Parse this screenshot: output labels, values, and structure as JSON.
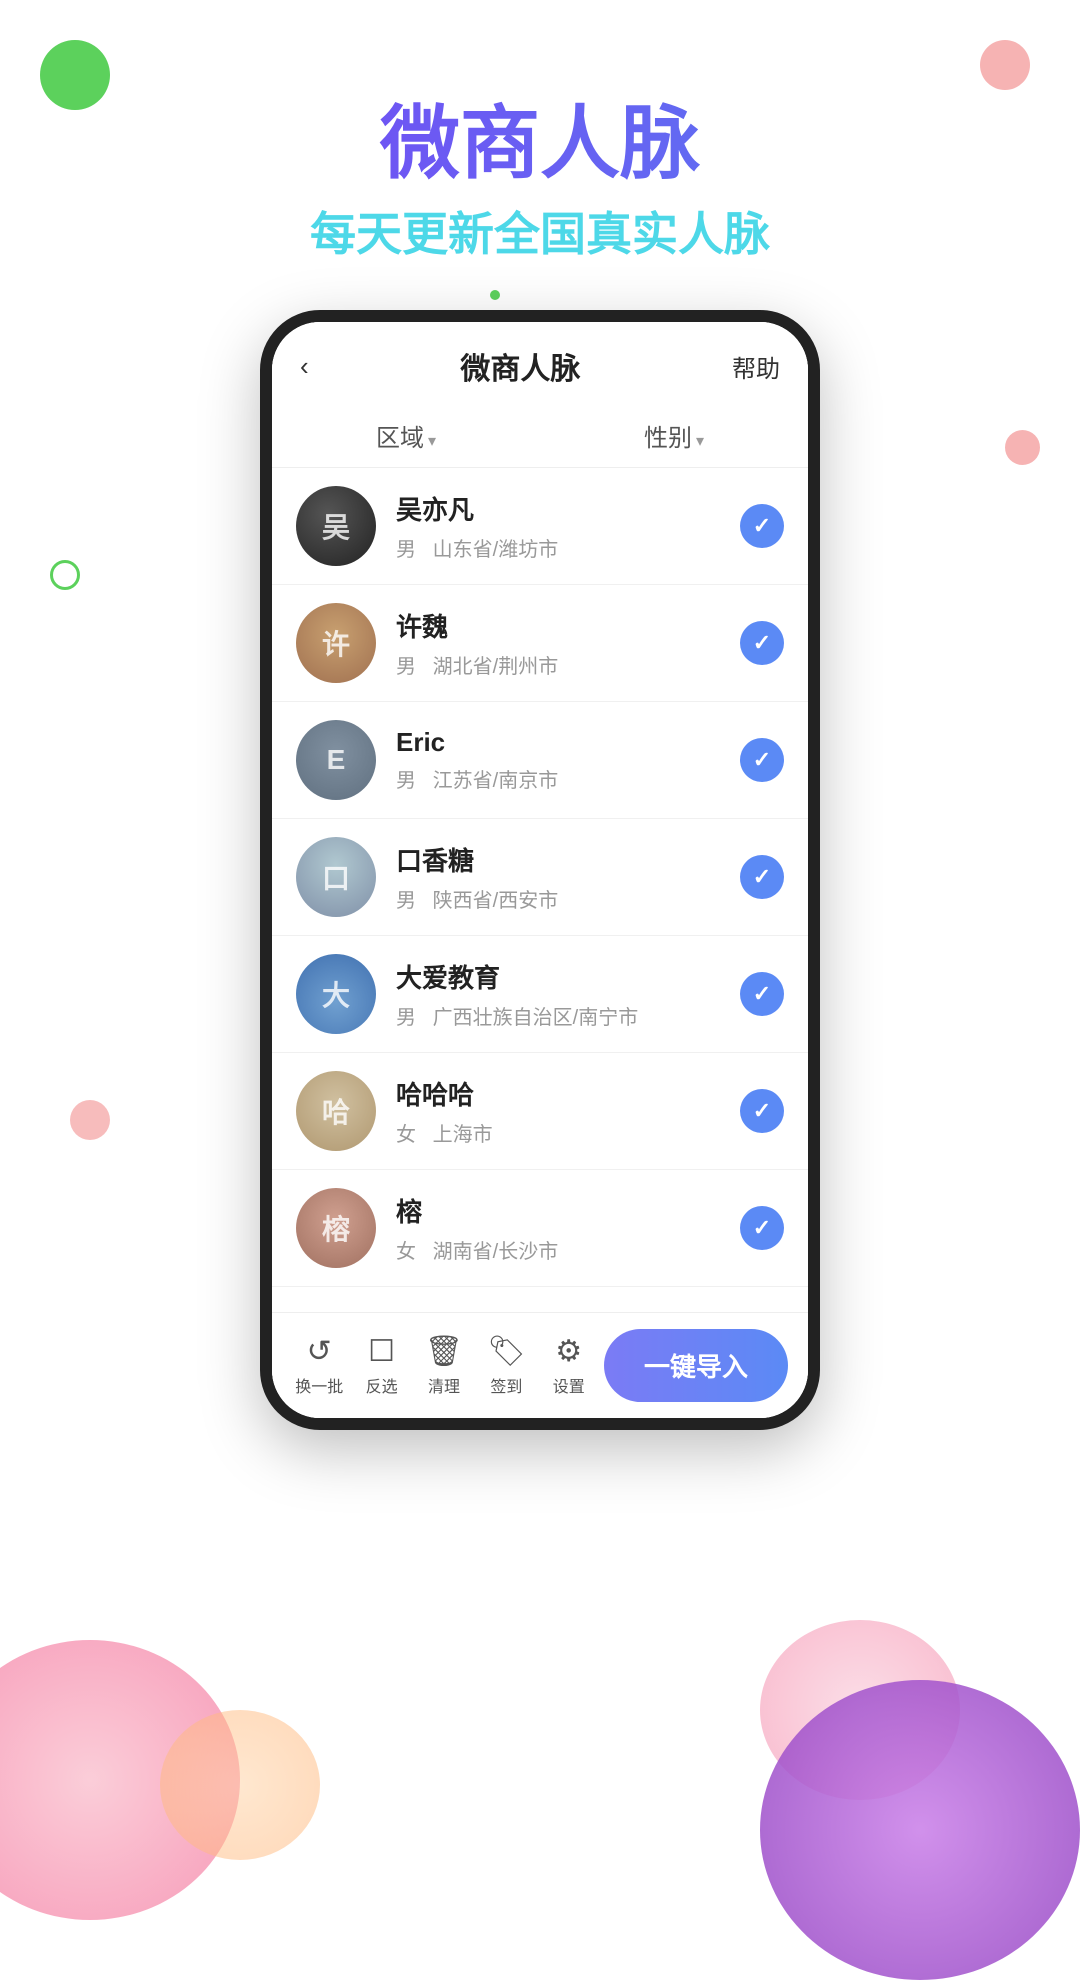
{
  "page": {
    "background_color": "#ffffff"
  },
  "header": {
    "main_title": "微商人脉",
    "sub_title": "每天更新全国真实人脉"
  },
  "phone": {
    "title": "微商人脉",
    "back_label": "‹",
    "help_label": "帮助",
    "filter_tabs": [
      {
        "label": "区域"
      },
      {
        "label": "性别"
      }
    ],
    "contacts": [
      {
        "id": 1,
        "name": "吴亦凡",
        "gender": "男",
        "location": "山东省/潍坊市",
        "avatar_class": "avatar-1",
        "avatar_letter": "吴",
        "checked": true
      },
      {
        "id": 2,
        "name": "许魏",
        "gender": "男",
        "location": "湖北省/荆州市",
        "avatar_class": "avatar-2",
        "avatar_letter": "许",
        "checked": true
      },
      {
        "id": 3,
        "name": "Eric",
        "gender": "男",
        "location": "江苏省/南京市",
        "avatar_class": "avatar-3",
        "avatar_letter": "E",
        "checked": true
      },
      {
        "id": 4,
        "name": "口香糖",
        "gender": "男",
        "location": "陕西省/西安市",
        "avatar_class": "avatar-4",
        "avatar_letter": "口",
        "checked": true
      },
      {
        "id": 5,
        "name": "大爱教育",
        "gender": "男",
        "location": "广西壮族自治区/南宁市",
        "avatar_class": "avatar-5",
        "avatar_letter": "大",
        "checked": true
      },
      {
        "id": 6,
        "name": "哈哈哈",
        "gender": "女",
        "location": "上海市",
        "avatar_class": "avatar-6",
        "avatar_letter": "哈",
        "checked": true
      },
      {
        "id": 7,
        "name": "榕",
        "gender": "女",
        "location": "湖南省/长沙市",
        "avatar_class": "avatar-7",
        "avatar_letter": "榕",
        "checked": true
      }
    ],
    "toolbar": {
      "items": [
        {
          "id": "refresh",
          "icon": "↺",
          "label": "换一批"
        },
        {
          "id": "invert",
          "icon": "☐",
          "label": "反选"
        },
        {
          "id": "clear",
          "icon": "🗑",
          "label": "清理"
        },
        {
          "id": "tag",
          "icon": "🏷",
          "label": "签到"
        },
        {
          "id": "settings",
          "icon": "⚙",
          "label": "设置"
        }
      ],
      "import_button_label": "一键导入"
    }
  }
}
